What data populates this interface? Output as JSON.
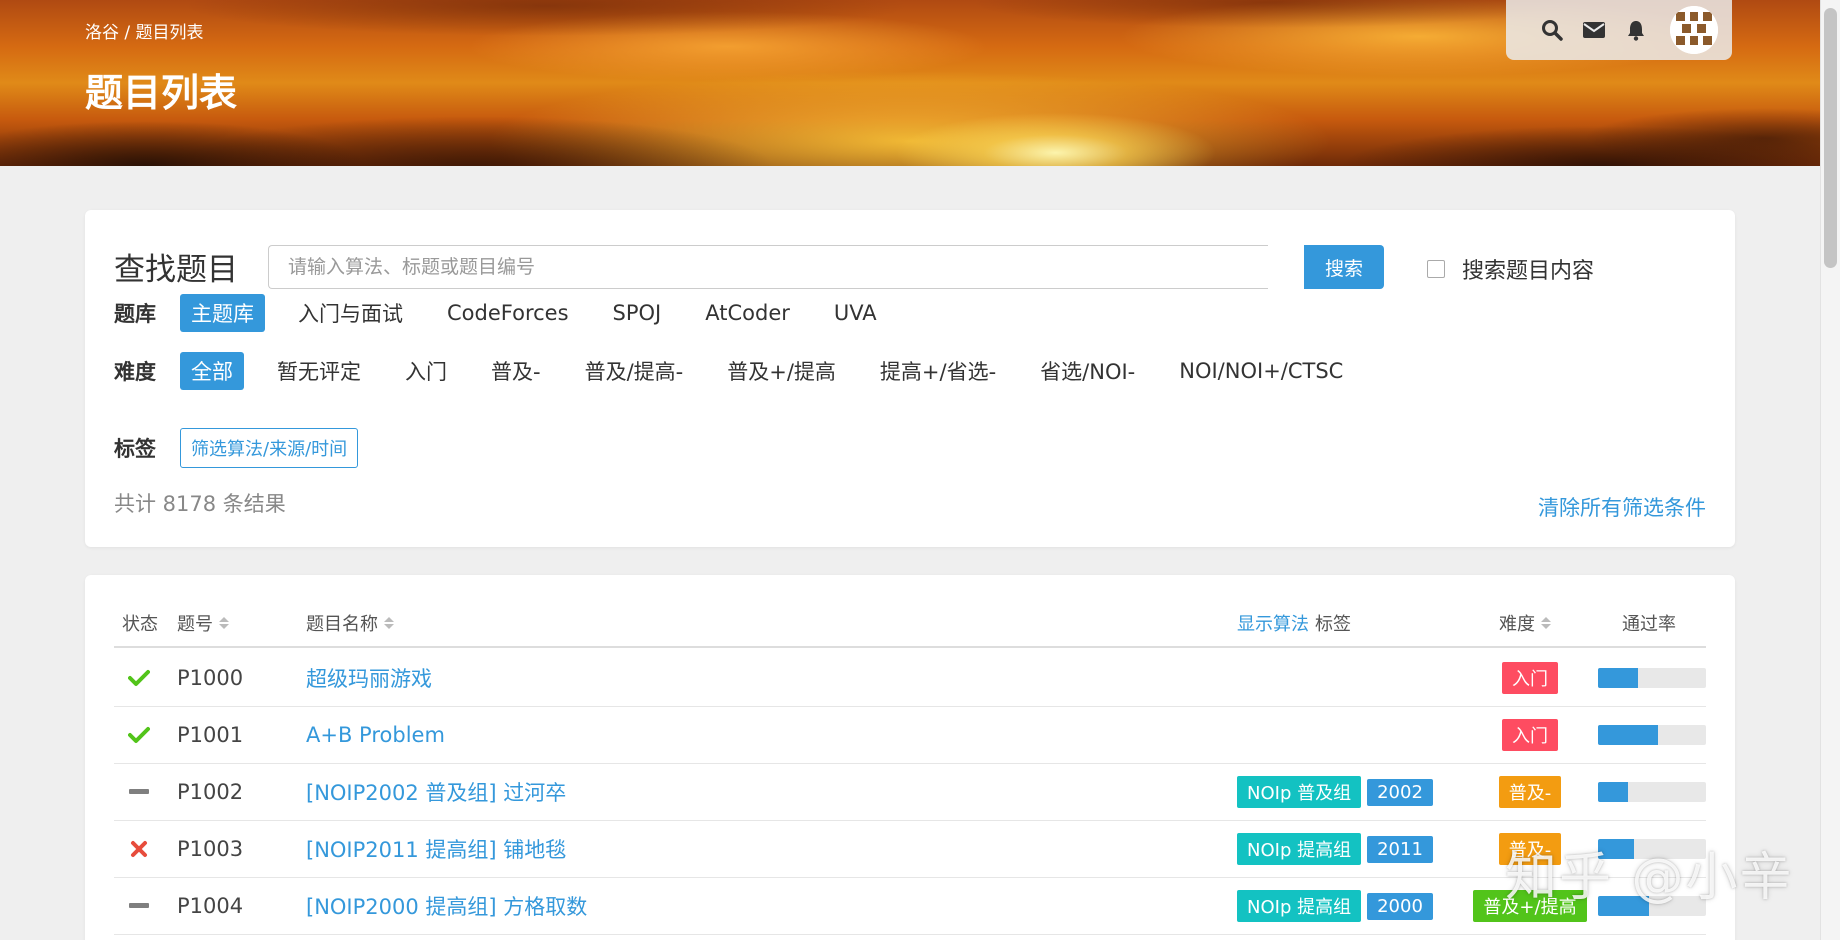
{
  "header": {
    "breadcrumb": "洛谷 / 题目列表",
    "title": "题目列表"
  },
  "user_nav": {
    "icons": [
      "search-icon",
      "mail-icon",
      "bell-icon",
      "avatar"
    ]
  },
  "search": {
    "heading": "查找题目",
    "placeholder": "请输入算法、标题或题目编号",
    "button": "搜索",
    "content_checkbox_label": "搜索题目内容",
    "content_checkbox_checked": false
  },
  "filters": {
    "source_label": "题库",
    "sources": [
      {
        "label": "主题库",
        "active": true
      },
      {
        "label": "入门与面试",
        "active": false
      },
      {
        "label": "CodeForces",
        "active": false
      },
      {
        "label": "SPOJ",
        "active": false
      },
      {
        "label": "AtCoder",
        "active": false
      },
      {
        "label": "UVA",
        "active": false
      }
    ],
    "difficulty_label": "难度",
    "difficulties": [
      {
        "label": "全部",
        "active": true
      },
      {
        "label": "暂无评定",
        "active": false
      },
      {
        "label": "入门",
        "active": false
      },
      {
        "label": "普及-",
        "active": false
      },
      {
        "label": "普及/提高-",
        "active": false
      },
      {
        "label": "普及+/提高",
        "active": false
      },
      {
        "label": "提高+/省选-",
        "active": false
      },
      {
        "label": "省选/NOI-",
        "active": false
      },
      {
        "label": "NOI/NOI+/CTSC",
        "active": false
      }
    ],
    "tag_label": "标签",
    "tag_button": "筛选算法/来源/时间"
  },
  "results": {
    "count_text": "共计 8178 条结果",
    "clear_link": "清除所有筛选条件"
  },
  "table": {
    "col_status": "状态",
    "col_pid": "题号",
    "col_title": "题目名称",
    "col_show_algo": "显示算法",
    "col_tags": "标签",
    "col_difficulty": "难度",
    "col_passrate": "通过率",
    "rows": [
      {
        "status": "accepted",
        "pid": "P1000",
        "title": "超级玛丽游戏",
        "tags": [],
        "difficulty": "入门",
        "difficulty_color": "#fe4c61",
        "pass_rate": 0.37
      },
      {
        "status": "accepted",
        "pid": "P1001",
        "title": "A+B Problem",
        "tags": [],
        "difficulty": "入门",
        "difficulty_color": "#fe4c61",
        "pass_rate": 0.56
      },
      {
        "status": "none",
        "pid": "P1002",
        "title": "[NOIP2002 普及组] 过河卒",
        "tags": [
          {
            "label": "NOIp 普及组",
            "color": "#13c2c2"
          },
          {
            "label": "2002",
            "color": "#3498db"
          }
        ],
        "difficulty": "普及-",
        "difficulty_color": "#f39c11",
        "pass_rate": 0.28
      },
      {
        "status": "wrong",
        "pid": "P1003",
        "title": "[NOIP2011 提高组] 铺地毯",
        "tags": [
          {
            "label": "NOIp 提高组",
            "color": "#13c2c2"
          },
          {
            "label": "2011",
            "color": "#3498db"
          }
        ],
        "difficulty": "普及-",
        "difficulty_color": "#f39c11",
        "pass_rate": 0.33
      },
      {
        "status": "none",
        "pid": "P1004",
        "title": "[NOIP2000 提高组] 方格取数",
        "tags": [
          {
            "label": "NOIp 提高组",
            "color": "#13c2c2"
          },
          {
            "label": "2000",
            "color": "#3498db"
          }
        ],
        "difficulty": "普及+/提高",
        "difficulty_color": "#52c41a",
        "pass_rate": 0.47
      }
    ]
  },
  "watermark": "知乎 @小辛",
  "colors": {
    "accent": "#3498db",
    "accepted": "#52c41a",
    "wrong": "#e74c3c",
    "none": "#7f7f7f"
  }
}
